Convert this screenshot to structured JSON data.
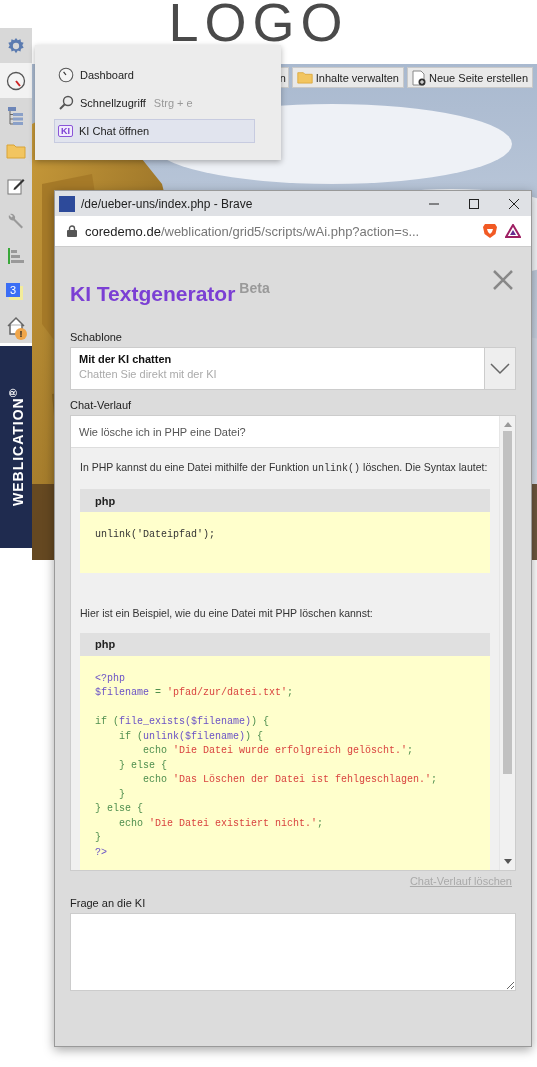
{
  "page": {
    "logo": "LOGO",
    "toolbar": [
      {
        "label": "n",
        "kind": "plain"
      },
      {
        "label": "Inhalte verwalten",
        "kind": "folder"
      },
      {
        "label": "Neue Seite erstellen",
        "kind": "new-page"
      }
    ]
  },
  "sidebar": {
    "items": [
      {
        "kind": "gear",
        "selected": false
      },
      {
        "kind": "gauge",
        "selected": true
      },
      {
        "kind": "tree",
        "selected": false
      },
      {
        "kind": "folder",
        "selected": false
      },
      {
        "kind": "edit",
        "selected": false
      },
      {
        "kind": "wrench",
        "selected": false
      },
      {
        "kind": "chart",
        "selected": false
      },
      {
        "kind": "calendar",
        "badge": "3",
        "selected": false
      },
      {
        "kind": "house",
        "alert": "!",
        "selected": false
      }
    ],
    "brand": "WEBLICATION",
    "brand_mark": "®"
  },
  "menu": {
    "items": [
      {
        "kind": "gauge",
        "label": "Dashboard",
        "selected": false
      },
      {
        "kind": "search",
        "label": "Schnellzugriff",
        "shortcut": "Strg + e",
        "selected": false
      },
      {
        "kind": "ki",
        "icon_text": "KI",
        "label": "KI Chat öffnen",
        "selected": true
      }
    ]
  },
  "browser": {
    "title": "/de/ueber-uns/index.php - Brave",
    "address_host": "coredemo.de",
    "address_path": "/weblication/grid5/scripts/wAi.php?action=s..."
  },
  "dialog": {
    "title": "KI Textgenerator",
    "title_badge": "Beta",
    "template": {
      "label": "Schablone",
      "value": "Mit der KI chatten",
      "description": "Chatten Sie direkt mit der KI"
    },
    "chat": {
      "label": "Chat-Verlauf",
      "question": "Wie lösche ich in PHP eine Datei?",
      "answer": [
        {
          "kind": "paragraph",
          "segments": [
            {
              "kind": "text",
              "text": "In PHP kannst du eine Datei mithilfe der Funktion "
            },
            {
              "kind": "code",
              "text": "unlink()"
            },
            {
              "kind": "text",
              "text": " löschen. Die Syntax lautet:"
            }
          ]
        },
        {
          "kind": "code",
          "language": "php",
          "lines": [
            {
              "kind": "code",
              "tokens": [
                {
                  "kind": "plain",
                  "text": "unlink('Dateipfad');"
                }
              ]
            }
          ]
        },
        {
          "kind": "paragraph",
          "segments": [
            {
              "kind": "text",
              "text": "Hier ist ein Beispiel, wie du eine Datei mit PHP löschen kannst:"
            }
          ]
        },
        {
          "kind": "code",
          "language": "php",
          "lines": [
            {
              "kind": "code",
              "tokens": [
                {
                  "kind": "variable",
                  "text": "<?php"
                }
              ]
            },
            {
              "kind": "code",
              "tokens": [
                {
                  "kind": "variable",
                  "text": "$filename"
                },
                {
                  "kind": "keyword",
                  "text": " = "
                },
                {
                  "kind": "string",
                  "text": "'pfad/zur/datei.txt'"
                },
                {
                  "kind": "keyword",
                  "text": ";"
                }
              ]
            },
            {
              "kind": "blank"
            },
            {
              "kind": "code",
              "tokens": [
                {
                  "kind": "keyword",
                  "text": "if ("
                },
                {
                  "kind": "variable",
                  "text": "file_exists($filename)"
                },
                {
                  "kind": "keyword",
                  "text": ") {"
                }
              ]
            },
            {
              "kind": "code",
              "tokens": [
                {
                  "kind": "keyword",
                  "text": "    if ("
                },
                {
                  "kind": "variable",
                  "text": "unlink($filename)"
                },
                {
                  "kind": "keyword",
                  "text": ") {"
                }
              ]
            },
            {
              "kind": "code",
              "tokens": [
                {
                  "kind": "keyword",
                  "text": "        echo "
                },
                {
                  "kind": "string",
                  "text": "'Die Datei wurde erfolgreich gelöscht.'"
                },
                {
                  "kind": "keyword",
                  "text": ";"
                }
              ]
            },
            {
              "kind": "code",
              "tokens": [
                {
                  "kind": "keyword",
                  "text": "    } else {"
                }
              ]
            },
            {
              "kind": "code",
              "tokens": [
                {
                  "kind": "keyword",
                  "text": "        echo "
                },
                {
                  "kind": "string",
                  "text": "'Das Löschen der Datei ist fehlgeschlagen.'"
                },
                {
                  "kind": "keyword",
                  "text": ";"
                }
              ]
            },
            {
              "kind": "code",
              "tokens": [
                {
                  "kind": "keyword",
                  "text": "    }"
                }
              ]
            },
            {
              "kind": "code",
              "tokens": [
                {
                  "kind": "keyword",
                  "text": "} else {"
                }
              ]
            },
            {
              "kind": "code",
              "tokens": [
                {
                  "kind": "keyword",
                  "text": "    echo "
                },
                {
                  "kind": "string",
                  "text": "'Die Datei existiert nicht.'"
                },
                {
                  "kind": "keyword",
                  "text": ";"
                }
              ]
            },
            {
              "kind": "code",
              "tokens": [
                {
                  "kind": "keyword",
                  "text": "}"
                }
              ]
            },
            {
              "kind": "code",
              "tokens": [
                {
                  "kind": "variable",
                  "text": "?>"
                }
              ]
            }
          ]
        }
      ],
      "clear_link": "Chat-Verlauf löschen"
    },
    "question": {
      "label": "Frage an die KI"
    }
  }
}
